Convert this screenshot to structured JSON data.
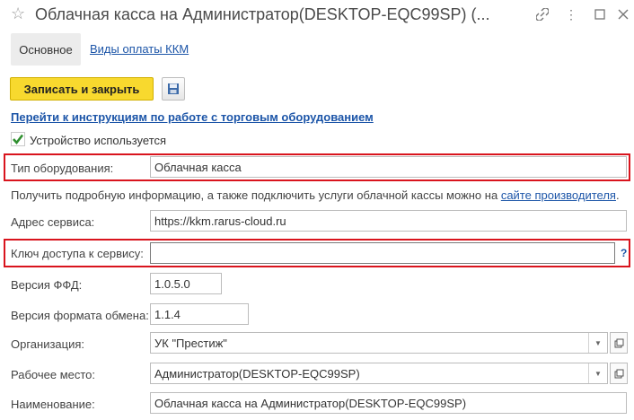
{
  "window": {
    "title": "Облачная касса на Администратор(DESKTOP-EQC99SP) (...",
    "star_icon": "star-icon",
    "link_icon": "link-icon",
    "menu_icon": "more-icon",
    "maximize_icon": "maximize-icon",
    "close_icon": "close-icon"
  },
  "tabs": [
    {
      "label": "Основное",
      "active": true
    },
    {
      "label": "Виды оплаты ККМ",
      "active": false
    }
  ],
  "toolbar": {
    "save_close_label": "Записать и закрыть",
    "save_icon": "floppy-disk-icon"
  },
  "instructions_link": "Перейти к инструкциям по работе с торговым оборудованием",
  "device_used": {
    "label": "Устройство используется",
    "checked": true
  },
  "fields": {
    "equipment_type": {
      "label": "Тип оборудования:",
      "value": "Облачная касса"
    },
    "info_text": "Получить подробную информацию, а также подключить услуги облачной кассы можно на",
    "info_link": "сайте производителя",
    "info_end": ".",
    "service_address": {
      "label": "Адрес сервиса:",
      "value": "https://kkm.rarus-cloud.ru"
    },
    "access_key": {
      "label": "Ключ доступа к сервису:",
      "value": "",
      "help": "?"
    },
    "ffd_version": {
      "label": "Версия ФФД:",
      "value": "1.0.5.0"
    },
    "exchange_format": {
      "label": "Версия формата обмена:",
      "value": "1.1.4"
    },
    "organization": {
      "label": "Организация:",
      "value": "УК \"Престиж\""
    },
    "workplace": {
      "label": "Рабочее место:",
      "value": "Администратор(DESKTOP-EQC99SP)"
    },
    "name": {
      "label": "Наименование:",
      "value": "Облачная касса на Администратор(DESKTOP-EQC99SP)"
    }
  },
  "colors": {
    "accent_yellow": "#f8d92e",
    "link_blue": "#1c55a8",
    "highlight_red": "#d9141d"
  }
}
